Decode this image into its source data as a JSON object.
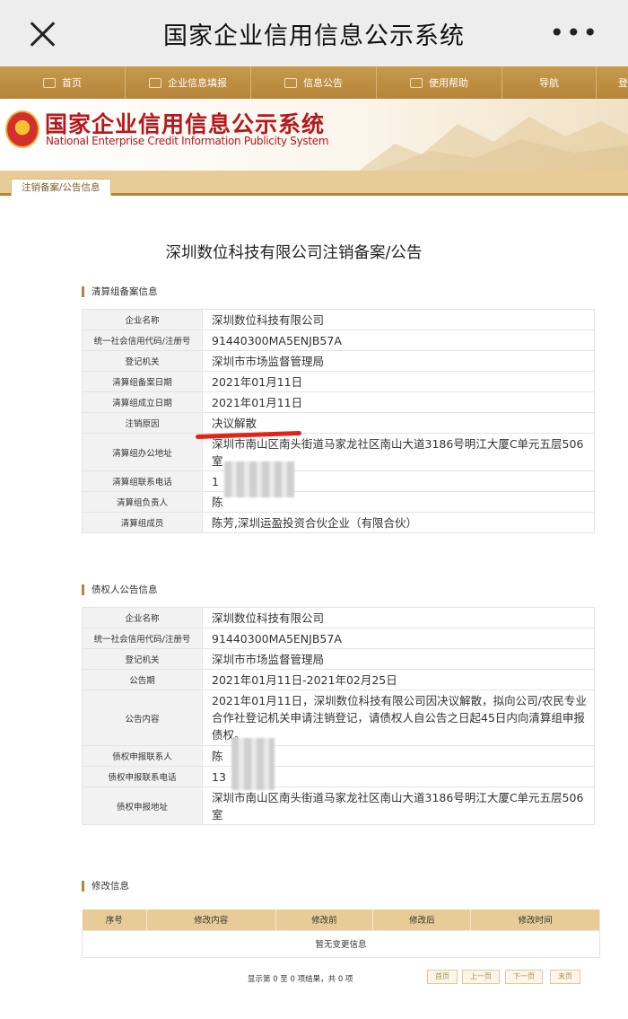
{
  "wechat": {
    "title": "国家企业信用信息公示系统",
    "more": "•••"
  },
  "nav": [
    "首页",
    "企业信息填报",
    "信息公告",
    "使用帮助",
    "导航",
    "登"
  ],
  "banner": {
    "title_cn": "国家企业信用信息公示系统",
    "title_en": "National Enterprise Credit Information Publicity System"
  },
  "tab": "注销备案/公告信息",
  "heading": "深圳数位科技有限公司注销备案/公告",
  "liquidation": {
    "title": "清算组备案信息",
    "rows": [
      {
        "k": "企业名称",
        "v": "深圳数位科技有限公司"
      },
      {
        "k": "统一社会信用代码/注册号",
        "v": "91440300MA5ENJB57A"
      },
      {
        "k": "登记机关",
        "v": "深圳市市场监督管理局"
      },
      {
        "k": "清算组备案日期",
        "v": "2021年01月11日"
      },
      {
        "k": "清算组成立日期",
        "v": "2021年01月11日"
      },
      {
        "k": "注销原因",
        "v": "决议解散"
      },
      {
        "k": "清算组办公地址",
        "v": "深圳市南山区南头街道马家龙社区南山大道3186号明江大厦C单元五层506室"
      },
      {
        "k": "清算组联系电话",
        "v": "1"
      },
      {
        "k": "清算组负责人",
        "v": "陈"
      },
      {
        "k": "清算组成员",
        "v": "陈芳,深圳运盈投资合伙企业（有限合伙）"
      }
    ]
  },
  "creditor": {
    "title": "债权人公告信息",
    "rows": [
      {
        "k": "企业名称",
        "v": "深圳数位科技有限公司"
      },
      {
        "k": "统一社会信用代码/注册号",
        "v": "91440300MA5ENJB57A"
      },
      {
        "k": "登记机关",
        "v": "深圳市市场监督管理局"
      },
      {
        "k": "公告期",
        "v": "2021年01月11日-2021年02月25日"
      },
      {
        "k": "公告内容",
        "v": "2021年01月11日，深圳数位科技有限公司因决议解散，拟向公司/农民专业合作社登记机关申请注销登记，请债权人自公告之日起45日内向清算组申报债权。"
      },
      {
        "k": "债权申报联系人",
        "v": "陈"
      },
      {
        "k": "债权申报联系电话",
        "v": "13"
      },
      {
        "k": "债权申报地址",
        "v": "深圳市南山区南头街道马家龙社区南山大道3186号明江大厦C单元五层506室"
      }
    ]
  },
  "modification": {
    "title": "修改信息",
    "headers": [
      "序号",
      "修改内容",
      "修改前",
      "修改后",
      "修改时间"
    ],
    "empty": "暂无变更信息",
    "pager_info": "显示第 0 至 0 项结果，共 0 项",
    "pager": [
      "首页",
      "上一页",
      "下一页",
      "末页"
    ]
  },
  "colors": {
    "nav": "#b5843a",
    "brand_red": "#b4191e",
    "highlight": "#e2231a"
  }
}
